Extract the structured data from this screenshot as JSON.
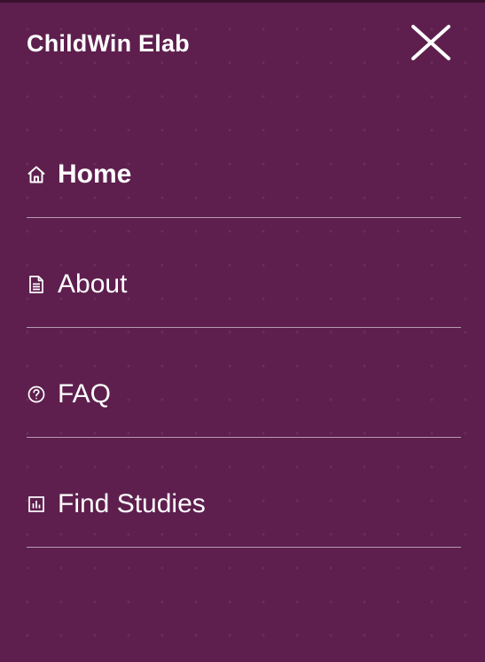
{
  "app": {
    "title": "ChildWin Elab"
  },
  "header": {
    "close_icon": "close-icon"
  },
  "menu": {
    "items": [
      {
        "label": "Home",
        "icon": "home-icon",
        "active": true
      },
      {
        "label": "About",
        "icon": "document-icon",
        "active": false
      },
      {
        "label": "FAQ",
        "icon": "question-circle-icon",
        "active": false
      },
      {
        "label": "Find Studies",
        "icon": "bar-chart-icon",
        "active": false
      }
    ]
  },
  "colors": {
    "background": "#5e1f4e",
    "text": "#ffffff",
    "divider": "rgba(255,255,255,0.55)"
  }
}
